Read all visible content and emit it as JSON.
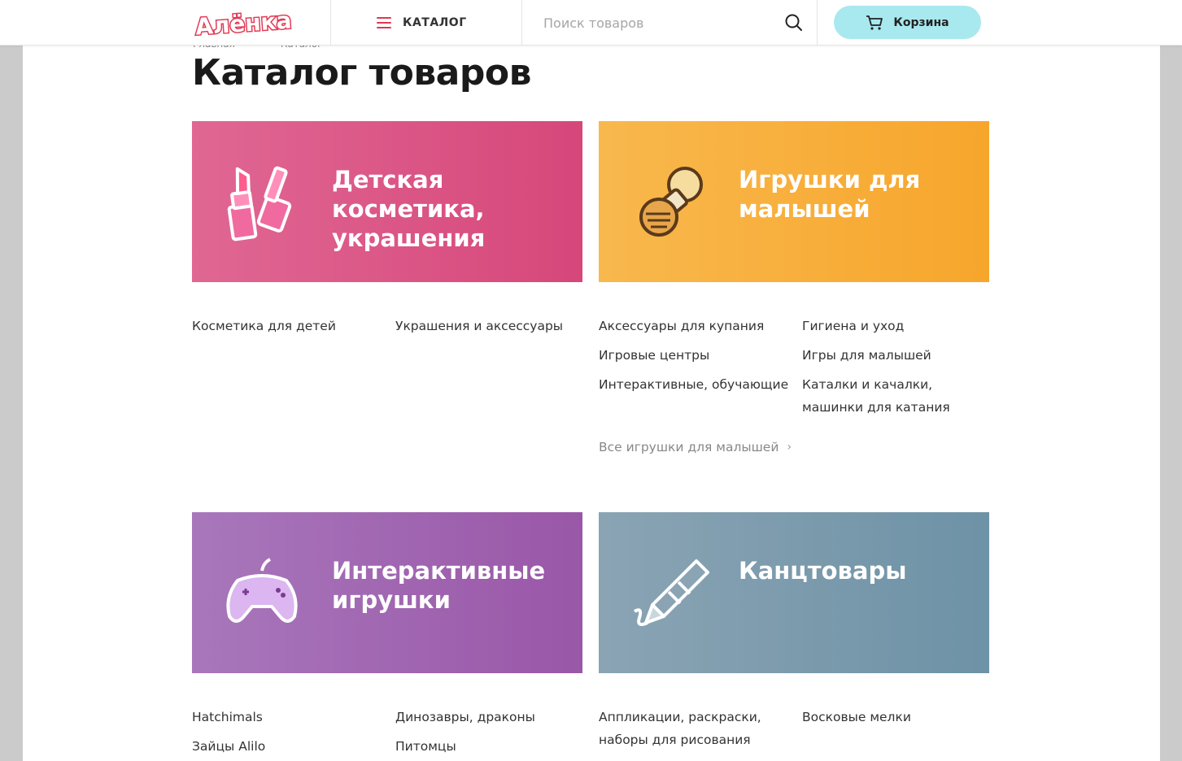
{
  "header": {
    "logo_text": "Алёнка",
    "catalog_label": "КАТАЛОГ",
    "search_placeholder": "Поиск товаров",
    "cart_label": "Корзина",
    "accent_color": "#e2364f",
    "cart_color": "#a8e9ef"
  },
  "breadcrumb": [
    "Главная",
    "Каталог"
  ],
  "page_title": "Каталог товаров",
  "categories": [
    {
      "title": "Детская косметика, украшения",
      "icon": "cosmetics-icon",
      "color": "#d6477a",
      "links": [
        "Косметика для детей",
        "Украшения и аксессуары"
      ]
    },
    {
      "title": "Игрушки для малышей",
      "icon": "pacifier-icon",
      "color": "#f7a62c",
      "links": [
        "Аксессуары для купания",
        "Гигиена и уход",
        "Игровые центры",
        "Игры для малышей",
        "Интерактивные, обучающие",
        "Каталки и качалки, машинки для катания"
      ],
      "more": "Все игрушки для малышей"
    },
    {
      "title": "Интерактивные игрушки",
      "icon": "gamepad-icon",
      "color": "#9a57a8",
      "links": [
        "Hatchimals",
        "Динозавры, драконы",
        "Зайцы Alilo",
        "Питомцы"
      ]
    },
    {
      "title": "Канцтовары",
      "icon": "crayon-icon",
      "color": "#6e92a6",
      "links": [
        "Аппликации, раскраски, наборы для рисования",
        "Восковые мелки"
      ]
    }
  ]
}
